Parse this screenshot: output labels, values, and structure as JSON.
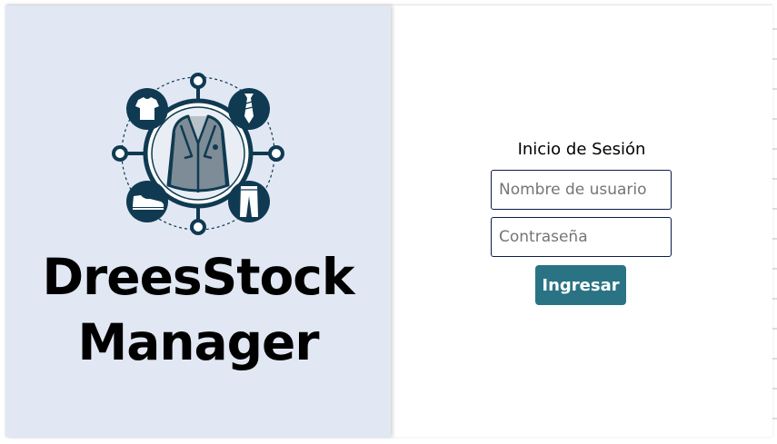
{
  "brand": {
    "line1": "DreesStock",
    "line2": "Manager",
    "colors": {
      "panel_bg": "#e1e8f4",
      "logo_dark": "#0f3a52",
      "jacket": "#7d8c96"
    }
  },
  "logo": {
    "icons": [
      "tshirt-icon",
      "tie-icon",
      "shoe-icon",
      "pants-icon",
      "jacket-icon"
    ]
  },
  "login": {
    "title": "Inicio de Sesión",
    "username_placeholder": "Nombre de usuario",
    "password_placeholder": "Contraseña",
    "submit_label": "Ingresar",
    "button_color": "#2a7385"
  }
}
